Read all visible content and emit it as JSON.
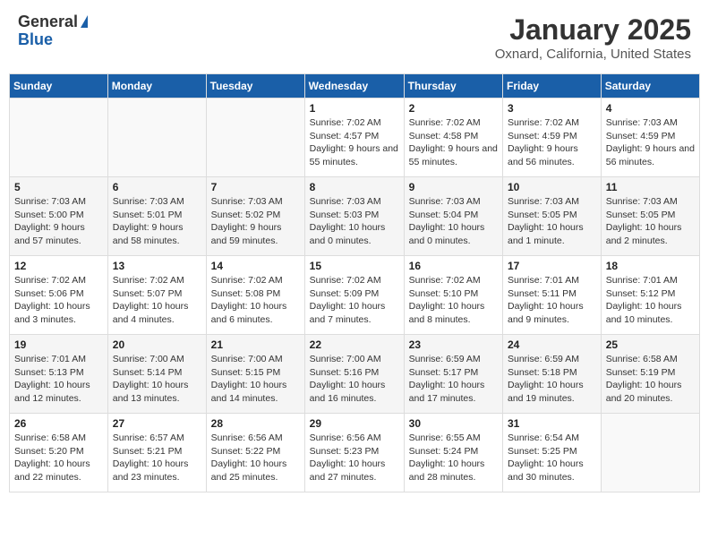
{
  "header": {
    "logo": {
      "line1": "General",
      "line2": "Blue"
    },
    "title": "January 2025",
    "subtitle": "Oxnard, California, United States"
  },
  "weekdays": [
    "Sunday",
    "Monday",
    "Tuesday",
    "Wednesday",
    "Thursday",
    "Friday",
    "Saturday"
  ],
  "weeks": [
    [
      {
        "day": "",
        "sunrise": "",
        "sunset": "",
        "daylight": ""
      },
      {
        "day": "",
        "sunrise": "",
        "sunset": "",
        "daylight": ""
      },
      {
        "day": "",
        "sunrise": "",
        "sunset": "",
        "daylight": ""
      },
      {
        "day": "1",
        "sunrise": "Sunrise: 7:02 AM",
        "sunset": "Sunset: 4:57 PM",
        "daylight": "Daylight: 9 hours and 55 minutes."
      },
      {
        "day": "2",
        "sunrise": "Sunrise: 7:02 AM",
        "sunset": "Sunset: 4:58 PM",
        "daylight": "Daylight: 9 hours and 55 minutes."
      },
      {
        "day": "3",
        "sunrise": "Sunrise: 7:02 AM",
        "sunset": "Sunset: 4:59 PM",
        "daylight": "Daylight: 9 hours and 56 minutes."
      },
      {
        "day": "4",
        "sunrise": "Sunrise: 7:03 AM",
        "sunset": "Sunset: 4:59 PM",
        "daylight": "Daylight: 9 hours and 56 minutes."
      }
    ],
    [
      {
        "day": "5",
        "sunrise": "Sunrise: 7:03 AM",
        "sunset": "Sunset: 5:00 PM",
        "daylight": "Daylight: 9 hours and 57 minutes."
      },
      {
        "day": "6",
        "sunrise": "Sunrise: 7:03 AM",
        "sunset": "Sunset: 5:01 PM",
        "daylight": "Daylight: 9 hours and 58 minutes."
      },
      {
        "day": "7",
        "sunrise": "Sunrise: 7:03 AM",
        "sunset": "Sunset: 5:02 PM",
        "daylight": "Daylight: 9 hours and 59 minutes."
      },
      {
        "day": "8",
        "sunrise": "Sunrise: 7:03 AM",
        "sunset": "Sunset: 5:03 PM",
        "daylight": "Daylight: 10 hours and 0 minutes."
      },
      {
        "day": "9",
        "sunrise": "Sunrise: 7:03 AM",
        "sunset": "Sunset: 5:04 PM",
        "daylight": "Daylight: 10 hours and 0 minutes."
      },
      {
        "day": "10",
        "sunrise": "Sunrise: 7:03 AM",
        "sunset": "Sunset: 5:05 PM",
        "daylight": "Daylight: 10 hours and 1 minute."
      },
      {
        "day": "11",
        "sunrise": "Sunrise: 7:03 AM",
        "sunset": "Sunset: 5:05 PM",
        "daylight": "Daylight: 10 hours and 2 minutes."
      }
    ],
    [
      {
        "day": "12",
        "sunrise": "Sunrise: 7:02 AM",
        "sunset": "Sunset: 5:06 PM",
        "daylight": "Daylight: 10 hours and 3 minutes."
      },
      {
        "day": "13",
        "sunrise": "Sunrise: 7:02 AM",
        "sunset": "Sunset: 5:07 PM",
        "daylight": "Daylight: 10 hours and 4 minutes."
      },
      {
        "day": "14",
        "sunrise": "Sunrise: 7:02 AM",
        "sunset": "Sunset: 5:08 PM",
        "daylight": "Daylight: 10 hours and 6 minutes."
      },
      {
        "day": "15",
        "sunrise": "Sunrise: 7:02 AM",
        "sunset": "Sunset: 5:09 PM",
        "daylight": "Daylight: 10 hours and 7 minutes."
      },
      {
        "day": "16",
        "sunrise": "Sunrise: 7:02 AM",
        "sunset": "Sunset: 5:10 PM",
        "daylight": "Daylight: 10 hours and 8 minutes."
      },
      {
        "day": "17",
        "sunrise": "Sunrise: 7:01 AM",
        "sunset": "Sunset: 5:11 PM",
        "daylight": "Daylight: 10 hours and 9 minutes."
      },
      {
        "day": "18",
        "sunrise": "Sunrise: 7:01 AM",
        "sunset": "Sunset: 5:12 PM",
        "daylight": "Daylight: 10 hours and 10 minutes."
      }
    ],
    [
      {
        "day": "19",
        "sunrise": "Sunrise: 7:01 AM",
        "sunset": "Sunset: 5:13 PM",
        "daylight": "Daylight: 10 hours and 12 minutes."
      },
      {
        "day": "20",
        "sunrise": "Sunrise: 7:00 AM",
        "sunset": "Sunset: 5:14 PM",
        "daylight": "Daylight: 10 hours and 13 minutes."
      },
      {
        "day": "21",
        "sunrise": "Sunrise: 7:00 AM",
        "sunset": "Sunset: 5:15 PM",
        "daylight": "Daylight: 10 hours and 14 minutes."
      },
      {
        "day": "22",
        "sunrise": "Sunrise: 7:00 AM",
        "sunset": "Sunset: 5:16 PM",
        "daylight": "Daylight: 10 hours and 16 minutes."
      },
      {
        "day": "23",
        "sunrise": "Sunrise: 6:59 AM",
        "sunset": "Sunset: 5:17 PM",
        "daylight": "Daylight: 10 hours and 17 minutes."
      },
      {
        "day": "24",
        "sunrise": "Sunrise: 6:59 AM",
        "sunset": "Sunset: 5:18 PM",
        "daylight": "Daylight: 10 hours and 19 minutes."
      },
      {
        "day": "25",
        "sunrise": "Sunrise: 6:58 AM",
        "sunset": "Sunset: 5:19 PM",
        "daylight": "Daylight: 10 hours and 20 minutes."
      }
    ],
    [
      {
        "day": "26",
        "sunrise": "Sunrise: 6:58 AM",
        "sunset": "Sunset: 5:20 PM",
        "daylight": "Daylight: 10 hours and 22 minutes."
      },
      {
        "day": "27",
        "sunrise": "Sunrise: 6:57 AM",
        "sunset": "Sunset: 5:21 PM",
        "daylight": "Daylight: 10 hours and 23 minutes."
      },
      {
        "day": "28",
        "sunrise": "Sunrise: 6:56 AM",
        "sunset": "Sunset: 5:22 PM",
        "daylight": "Daylight: 10 hours and 25 minutes."
      },
      {
        "day": "29",
        "sunrise": "Sunrise: 6:56 AM",
        "sunset": "Sunset: 5:23 PM",
        "daylight": "Daylight: 10 hours and 27 minutes."
      },
      {
        "day": "30",
        "sunrise": "Sunrise: 6:55 AM",
        "sunset": "Sunset: 5:24 PM",
        "daylight": "Daylight: 10 hours and 28 minutes."
      },
      {
        "day": "31",
        "sunrise": "Sunrise: 6:54 AM",
        "sunset": "Sunset: 5:25 PM",
        "daylight": "Daylight: 10 hours and 30 minutes."
      },
      {
        "day": "",
        "sunrise": "",
        "sunset": "",
        "daylight": ""
      }
    ]
  ]
}
